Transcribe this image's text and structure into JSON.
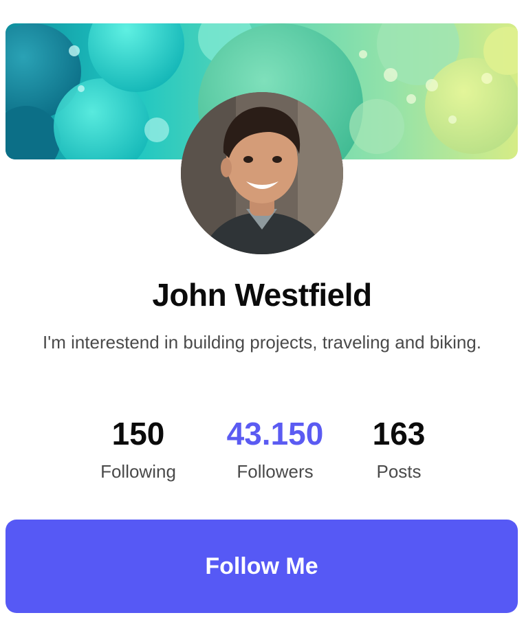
{
  "profile": {
    "cover_image": "cover-image",
    "avatar_image": "avatar-image",
    "name": "John Westfield",
    "bio": "I'm interestend in building projects, traveling and biking."
  },
  "stats": [
    {
      "value": "150",
      "label": "Following"
    },
    {
      "value": "43.150",
      "label": "Followers"
    },
    {
      "value": "163",
      "label": "Posts"
    }
  ],
  "actions": {
    "follow_label": "Follow Me"
  },
  "colors": {
    "accent": "#5659f5",
    "highlight_stat": "#5b5bf2",
    "name_text": "#0b0b0b",
    "secondary_text": "#4a4a4a"
  }
}
